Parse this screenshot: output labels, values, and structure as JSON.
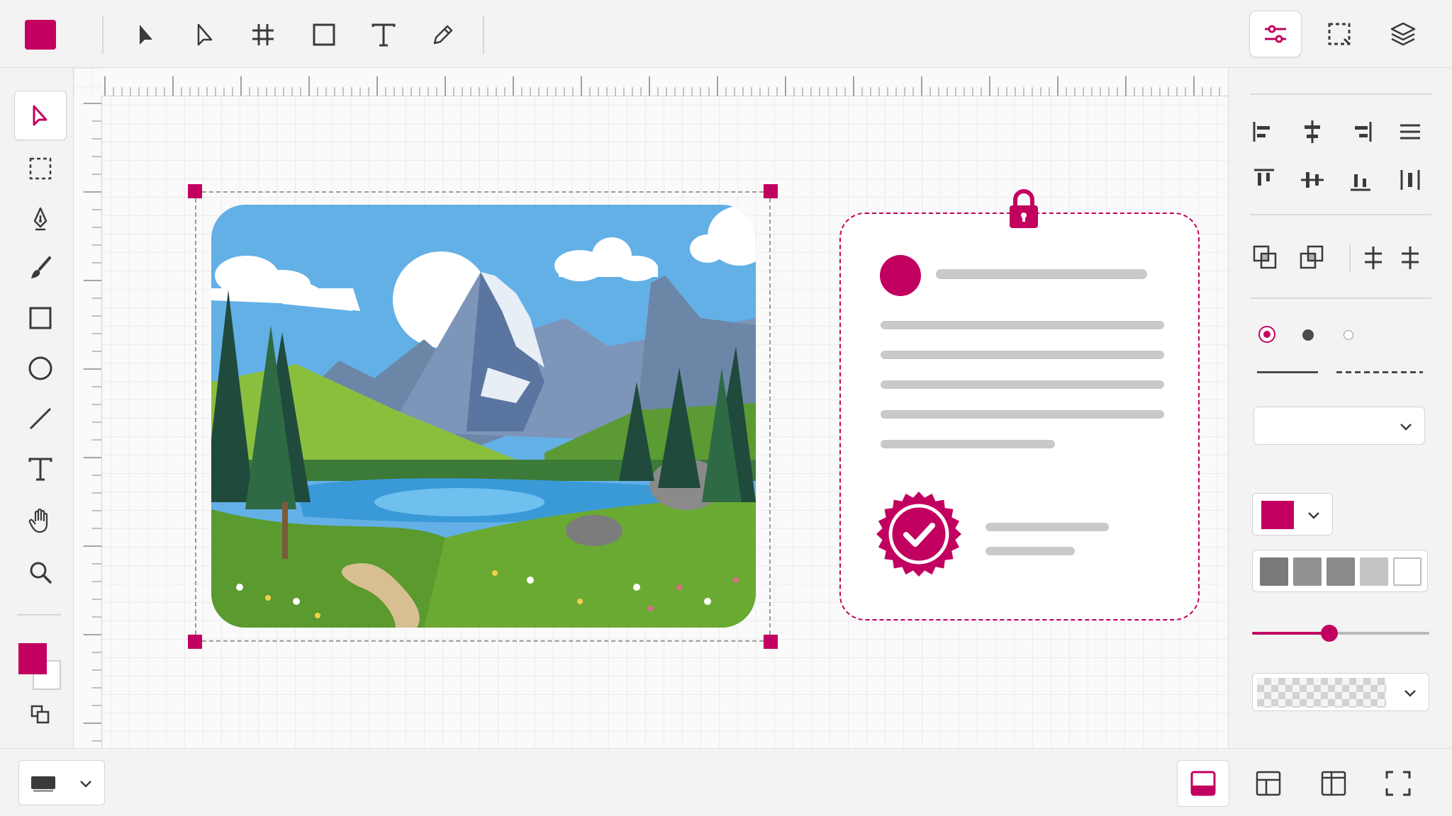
{
  "colors": {
    "accent": "#c2005f",
    "icon": "#3a3a3a",
    "placeholder_line": "#c9c9c9",
    "panel_bg": "#f3f3f3"
  },
  "topbar": {
    "color_swatch": "accent-color-swatch",
    "tools": [
      "select-arrow-icon",
      "direct-select-icon",
      "frame-grid-icon",
      "rectangle-icon",
      "text-icon",
      "pen-icon"
    ],
    "right_buttons": [
      {
        "icon": "adjustments-sliders-icon",
        "active": true
      },
      {
        "icon": "marquee-select-icon",
        "active": false
      },
      {
        "icon": "layers-icon",
        "active": false
      }
    ]
  },
  "left_toolbar": {
    "tools": [
      "pointer-icon",
      "marquee-icon",
      "pen-nib-icon",
      "brush-icon",
      "rectangle-icon",
      "ellipse-icon",
      "line-icon",
      "text-icon",
      "hand-icon",
      "zoom-icon"
    ],
    "active_tool": "pointer-icon",
    "foreground_color": "#c2005f",
    "background_color": "#ffffff"
  },
  "canvas": {
    "selected_object": "landscape-image",
    "card": {
      "locked": true,
      "has_avatar": true,
      "has_verified_badge": true
    }
  },
  "right_panel": {
    "align_icons_row1": [
      "align-left-icon",
      "align-center-horizontal-icon",
      "align-right-icon",
      "justify-icon"
    ],
    "align_icons_row2": [
      "align-top-icon",
      "align-middle-icon",
      "align-bottom-icon",
      "distribute-icon"
    ],
    "arrange_icons": [
      "bring-forward-icon",
      "send-backward-icon",
      "distribute-horizontal-icon",
      "distribute-vertical-icon"
    ],
    "stroke_size_selected": "large",
    "stroke_styles": [
      "solid",
      "dashed"
    ],
    "font_dropdown_value": "",
    "fill_color": "#c2005f",
    "palette": [
      "#7a7a7a",
      "#929292",
      "#8a8a8a",
      "#c4c4c4",
      "#ffffff"
    ],
    "opacity_slider_fraction": 0.34
  },
  "bottom_bar": {
    "device_select_icon": "device-monitor-icon",
    "layout_buttons": [
      {
        "icon": "layout-bottom-panel-icon",
        "active": true
      },
      {
        "icon": "layout-top-split-icon",
        "active": false
      },
      {
        "icon": "layout-columns-icon",
        "active": false
      },
      {
        "icon": "fullscreen-icon",
        "active": false
      }
    ]
  }
}
